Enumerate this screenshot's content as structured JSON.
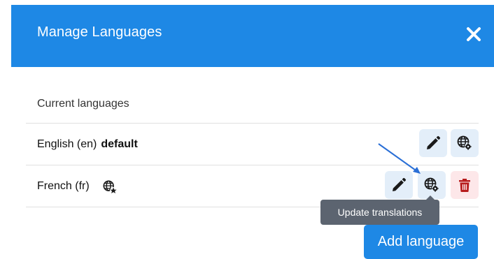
{
  "dialog": {
    "title": "Manage Languages",
    "close_icon": "close-icon"
  },
  "section": {
    "label": "Current languages"
  },
  "languages": [
    {
      "name": "English (en)",
      "tag": "default",
      "actions": [
        "edit-icon",
        "globe-gear-icon"
      ]
    },
    {
      "name": "French (fr)",
      "badge_icon": "globe-star-icon",
      "actions": [
        "edit-icon",
        "globe-gear-icon",
        "trash-icon"
      ]
    }
  ],
  "tooltip": {
    "text": "Update translations"
  },
  "footer": {
    "add_label": "Add language"
  },
  "colors": {
    "accent": "#1e88e5",
    "button_bg": "#e3eef9",
    "icon_dark": "#1a1a1a",
    "danger": "#b71c1c",
    "danger_bg": "#fde7e9",
    "annotation": "#2a6fd6"
  }
}
